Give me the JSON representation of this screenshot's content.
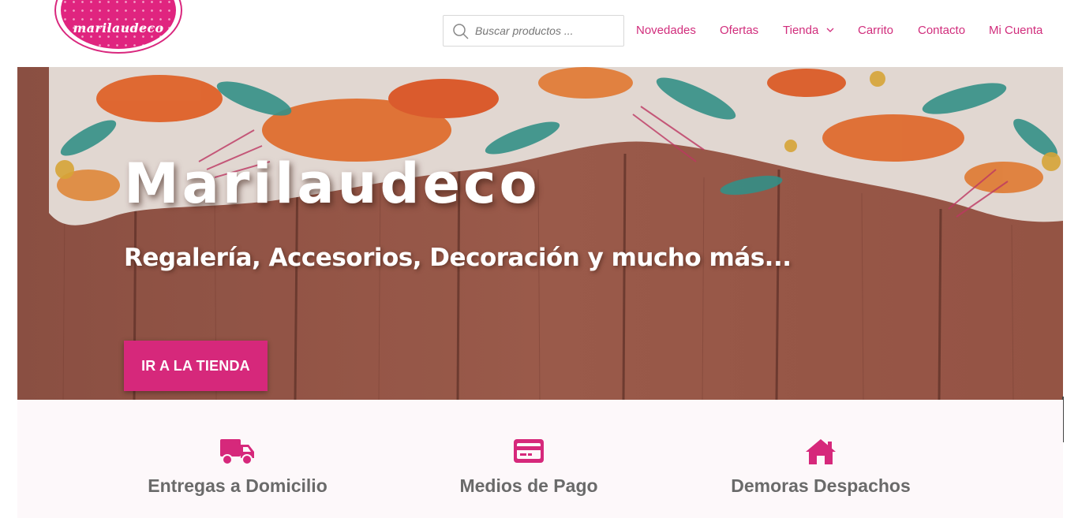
{
  "brand": {
    "logo_text": "marilaudeco",
    "accent": "#d6287b"
  },
  "search": {
    "placeholder": "Buscar productos ..."
  },
  "nav": {
    "items": [
      {
        "label": "Novedades"
      },
      {
        "label": "Ofertas"
      },
      {
        "label": "Tienda",
        "has_dropdown": true
      },
      {
        "label": "Carrito"
      },
      {
        "label": "Contacto"
      },
      {
        "label": "Mi Cuenta"
      }
    ]
  },
  "hero": {
    "title": "Marilaudeco",
    "subtitle": "Regalería, Accesorios, Decoración y mucho más...",
    "cta_label": "IR A LA TIENDA"
  },
  "features": [
    {
      "icon": "truck-icon",
      "label": "Entregas a Domicilio"
    },
    {
      "icon": "credit-card-icon",
      "label": "Medios de Pago"
    },
    {
      "icon": "home-icon",
      "label": "Demoras Despachos"
    }
  ]
}
